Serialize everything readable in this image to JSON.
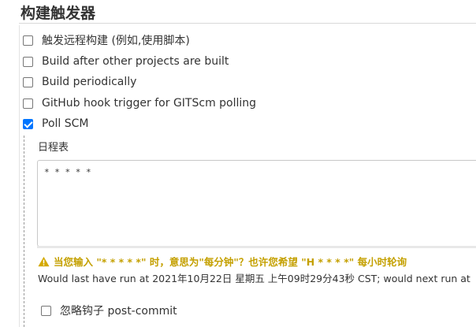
{
  "section": {
    "title": "构建触发器"
  },
  "triggers": [
    {
      "label": "触发远程构建 (例如,使用脚本)",
      "checked": false
    },
    {
      "label": "Build after other projects are built",
      "checked": false
    },
    {
      "label": "Build periodically",
      "checked": false
    },
    {
      "label": "GitHub hook trigger for GITScm polling",
      "checked": false
    },
    {
      "label": "Poll SCM",
      "checked": true
    }
  ],
  "poll_scm": {
    "schedule_label": "日程表",
    "schedule_value": "* * * * *",
    "warning_text": "当您输入 \"* * * * *\" 时，意思为\"每分钟\"？也许您希望 \"H * * * *\" 每小时轮询",
    "info_text": "Would last have run at 2021年10月22日 星期五 上午09时29分43秒 CST; would next run at",
    "ignore_post_commit": {
      "label": "忽略钩子 post-commit",
      "checked": false
    }
  },
  "colors": {
    "warning": "#c4a000",
    "checkbox_checked": "#0075ff"
  }
}
